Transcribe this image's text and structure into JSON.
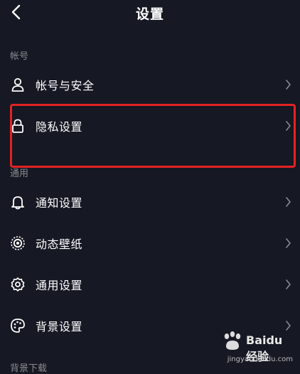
{
  "header": {
    "title": "设置",
    "back_icon": "chevron-left-icon"
  },
  "sections": [
    {
      "label": "帐号",
      "items": [
        {
          "label": "帐号与安全",
          "icon": "user-icon"
        },
        {
          "label": "隐私设置",
          "icon": "lock-icon"
        }
      ]
    },
    {
      "label": "通用",
      "items": [
        {
          "label": "通知设置",
          "icon": "bell-icon"
        },
        {
          "label": "动态壁纸",
          "icon": "live-wallpaper-icon"
        },
        {
          "label": "通用设置",
          "icon": "gear-icon"
        },
        {
          "label": "背景设置",
          "icon": "palette-icon"
        }
      ]
    }
  ],
  "partial_section_label": "背景下载",
  "watermark": {
    "brand": "Baidu经验",
    "url": "jingyan.baidu.com"
  },
  "colors": {
    "background": "#161823",
    "text": "#ffffff",
    "section_label": "#8a8b91",
    "chevron": "#8a8b91",
    "highlight": "#e22323"
  }
}
